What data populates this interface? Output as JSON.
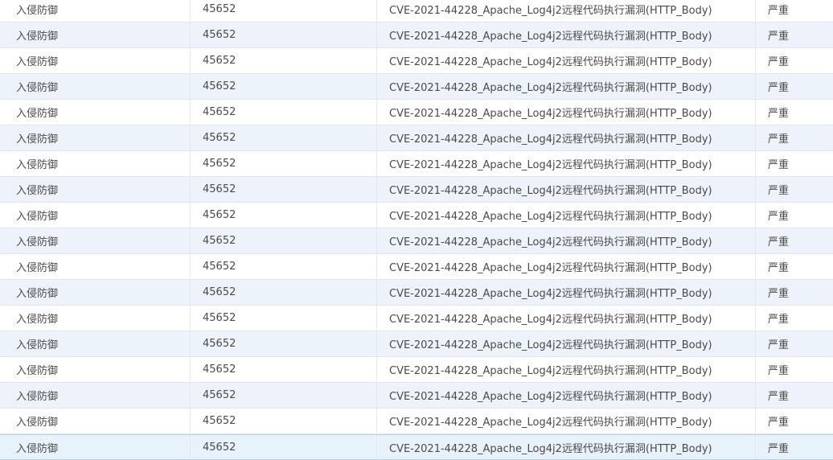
{
  "table": {
    "rows": [
      {
        "type": "入侵防御",
        "id": "45652",
        "event": "CVE-2021-44228_Apache_Log4j2远程代码执行漏洞(HTTP_Body)",
        "severity": "严重"
      },
      {
        "type": "入侵防御",
        "id": "45652",
        "event": "CVE-2021-44228_Apache_Log4j2远程代码执行漏洞(HTTP_Body)",
        "severity": "严重"
      },
      {
        "type": "入侵防御",
        "id": "45652",
        "event": "CVE-2021-44228_Apache_Log4j2远程代码执行漏洞(HTTP_Body)",
        "severity": "严重"
      },
      {
        "type": "入侵防御",
        "id": "45652",
        "event": "CVE-2021-44228_Apache_Log4j2远程代码执行漏洞(HTTP_Body)",
        "severity": "严重"
      },
      {
        "type": "入侵防御",
        "id": "45652",
        "event": "CVE-2021-44228_Apache_Log4j2远程代码执行漏洞(HTTP_Body)",
        "severity": "严重"
      },
      {
        "type": "入侵防御",
        "id": "45652",
        "event": "CVE-2021-44228_Apache_Log4j2远程代码执行漏洞(HTTP_Body)",
        "severity": "严重"
      },
      {
        "type": "入侵防御",
        "id": "45652",
        "event": "CVE-2021-44228_Apache_Log4j2远程代码执行漏洞(HTTP_Body)",
        "severity": "严重"
      },
      {
        "type": "入侵防御",
        "id": "45652",
        "event": "CVE-2021-44228_Apache_Log4j2远程代码执行漏洞(HTTP_Body)",
        "severity": "严重"
      },
      {
        "type": "入侵防御",
        "id": "45652",
        "event": "CVE-2021-44228_Apache_Log4j2远程代码执行漏洞(HTTP_Body)",
        "severity": "严重"
      },
      {
        "type": "入侵防御",
        "id": "45652",
        "event": "CVE-2021-44228_Apache_Log4j2远程代码执行漏洞(HTTP_Body)",
        "severity": "严重"
      },
      {
        "type": "入侵防御",
        "id": "45652",
        "event": "CVE-2021-44228_Apache_Log4j2远程代码执行漏洞(HTTP_Body)",
        "severity": "严重"
      },
      {
        "type": "入侵防御",
        "id": "45652",
        "event": "CVE-2021-44228_Apache_Log4j2远程代码执行漏洞(HTTP_Body)",
        "severity": "严重"
      },
      {
        "type": "入侵防御",
        "id": "45652",
        "event": "CVE-2021-44228_Apache_Log4j2远程代码执行漏洞(HTTP_Body)",
        "severity": "严重"
      },
      {
        "type": "入侵防御",
        "id": "45652",
        "event": "CVE-2021-44228_Apache_Log4j2远程代码执行漏洞(HTTP_Body)",
        "severity": "严重"
      },
      {
        "type": "入侵防御",
        "id": "45652",
        "event": "CVE-2021-44228_Apache_Log4j2远程代码执行漏洞(HTTP_Body)",
        "severity": "严重"
      },
      {
        "type": "入侵防御",
        "id": "45652",
        "event": "CVE-2021-44228_Apache_Log4j2远程代码执行漏洞(HTTP_Body)",
        "severity": "严重"
      },
      {
        "type": "入侵防御",
        "id": "45652",
        "event": "CVE-2021-44228_Apache_Log4j2远程代码执行漏洞(HTTP_Body)",
        "severity": "严重"
      },
      {
        "type": "入侵防御",
        "id": "45652",
        "event": "CVE-2021-44228_Apache_Log4j2远程代码执行漏洞(HTTP_Body)",
        "severity": "严重"
      }
    ],
    "selected_row": 17
  }
}
